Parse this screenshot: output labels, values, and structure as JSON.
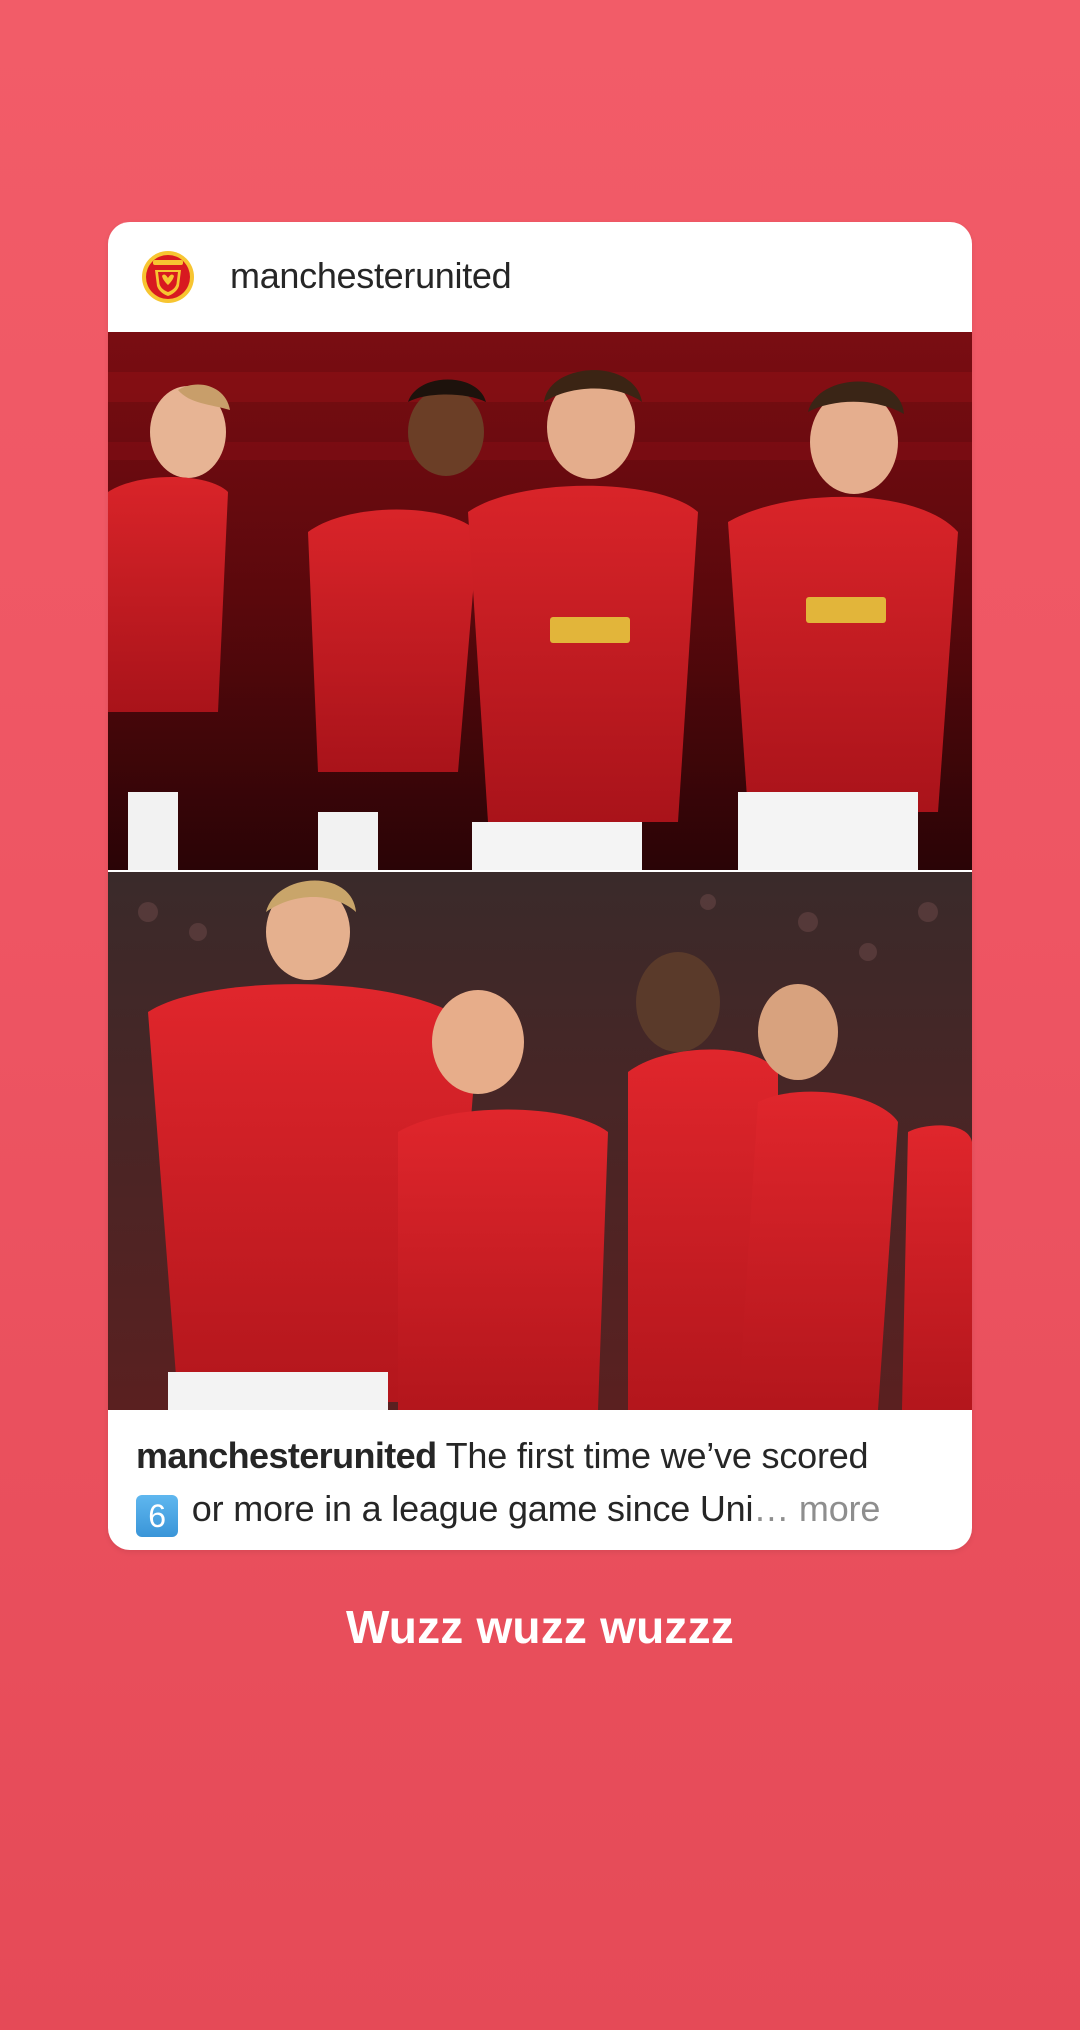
{
  "story": {
    "background_top": "#f25c68",
    "background_bottom": "#e54a57",
    "text": "Wuzz wuzz wuzzz"
  },
  "post": {
    "avatar_icon": "manchester-united-crest-icon",
    "username": "manchesterunited",
    "images": [
      {
        "name": "players-celebrating-2020-kit"
      },
      {
        "name": "players-celebrating-jones-4"
      }
    ],
    "caption": {
      "username": "manchesterunited",
      "text_line1": " The first time we’ve scored",
      "keycap": "6",
      "text_line2": " or more in a league game since Uni",
      "ellipsis": "…",
      "more_label": " more"
    }
  }
}
